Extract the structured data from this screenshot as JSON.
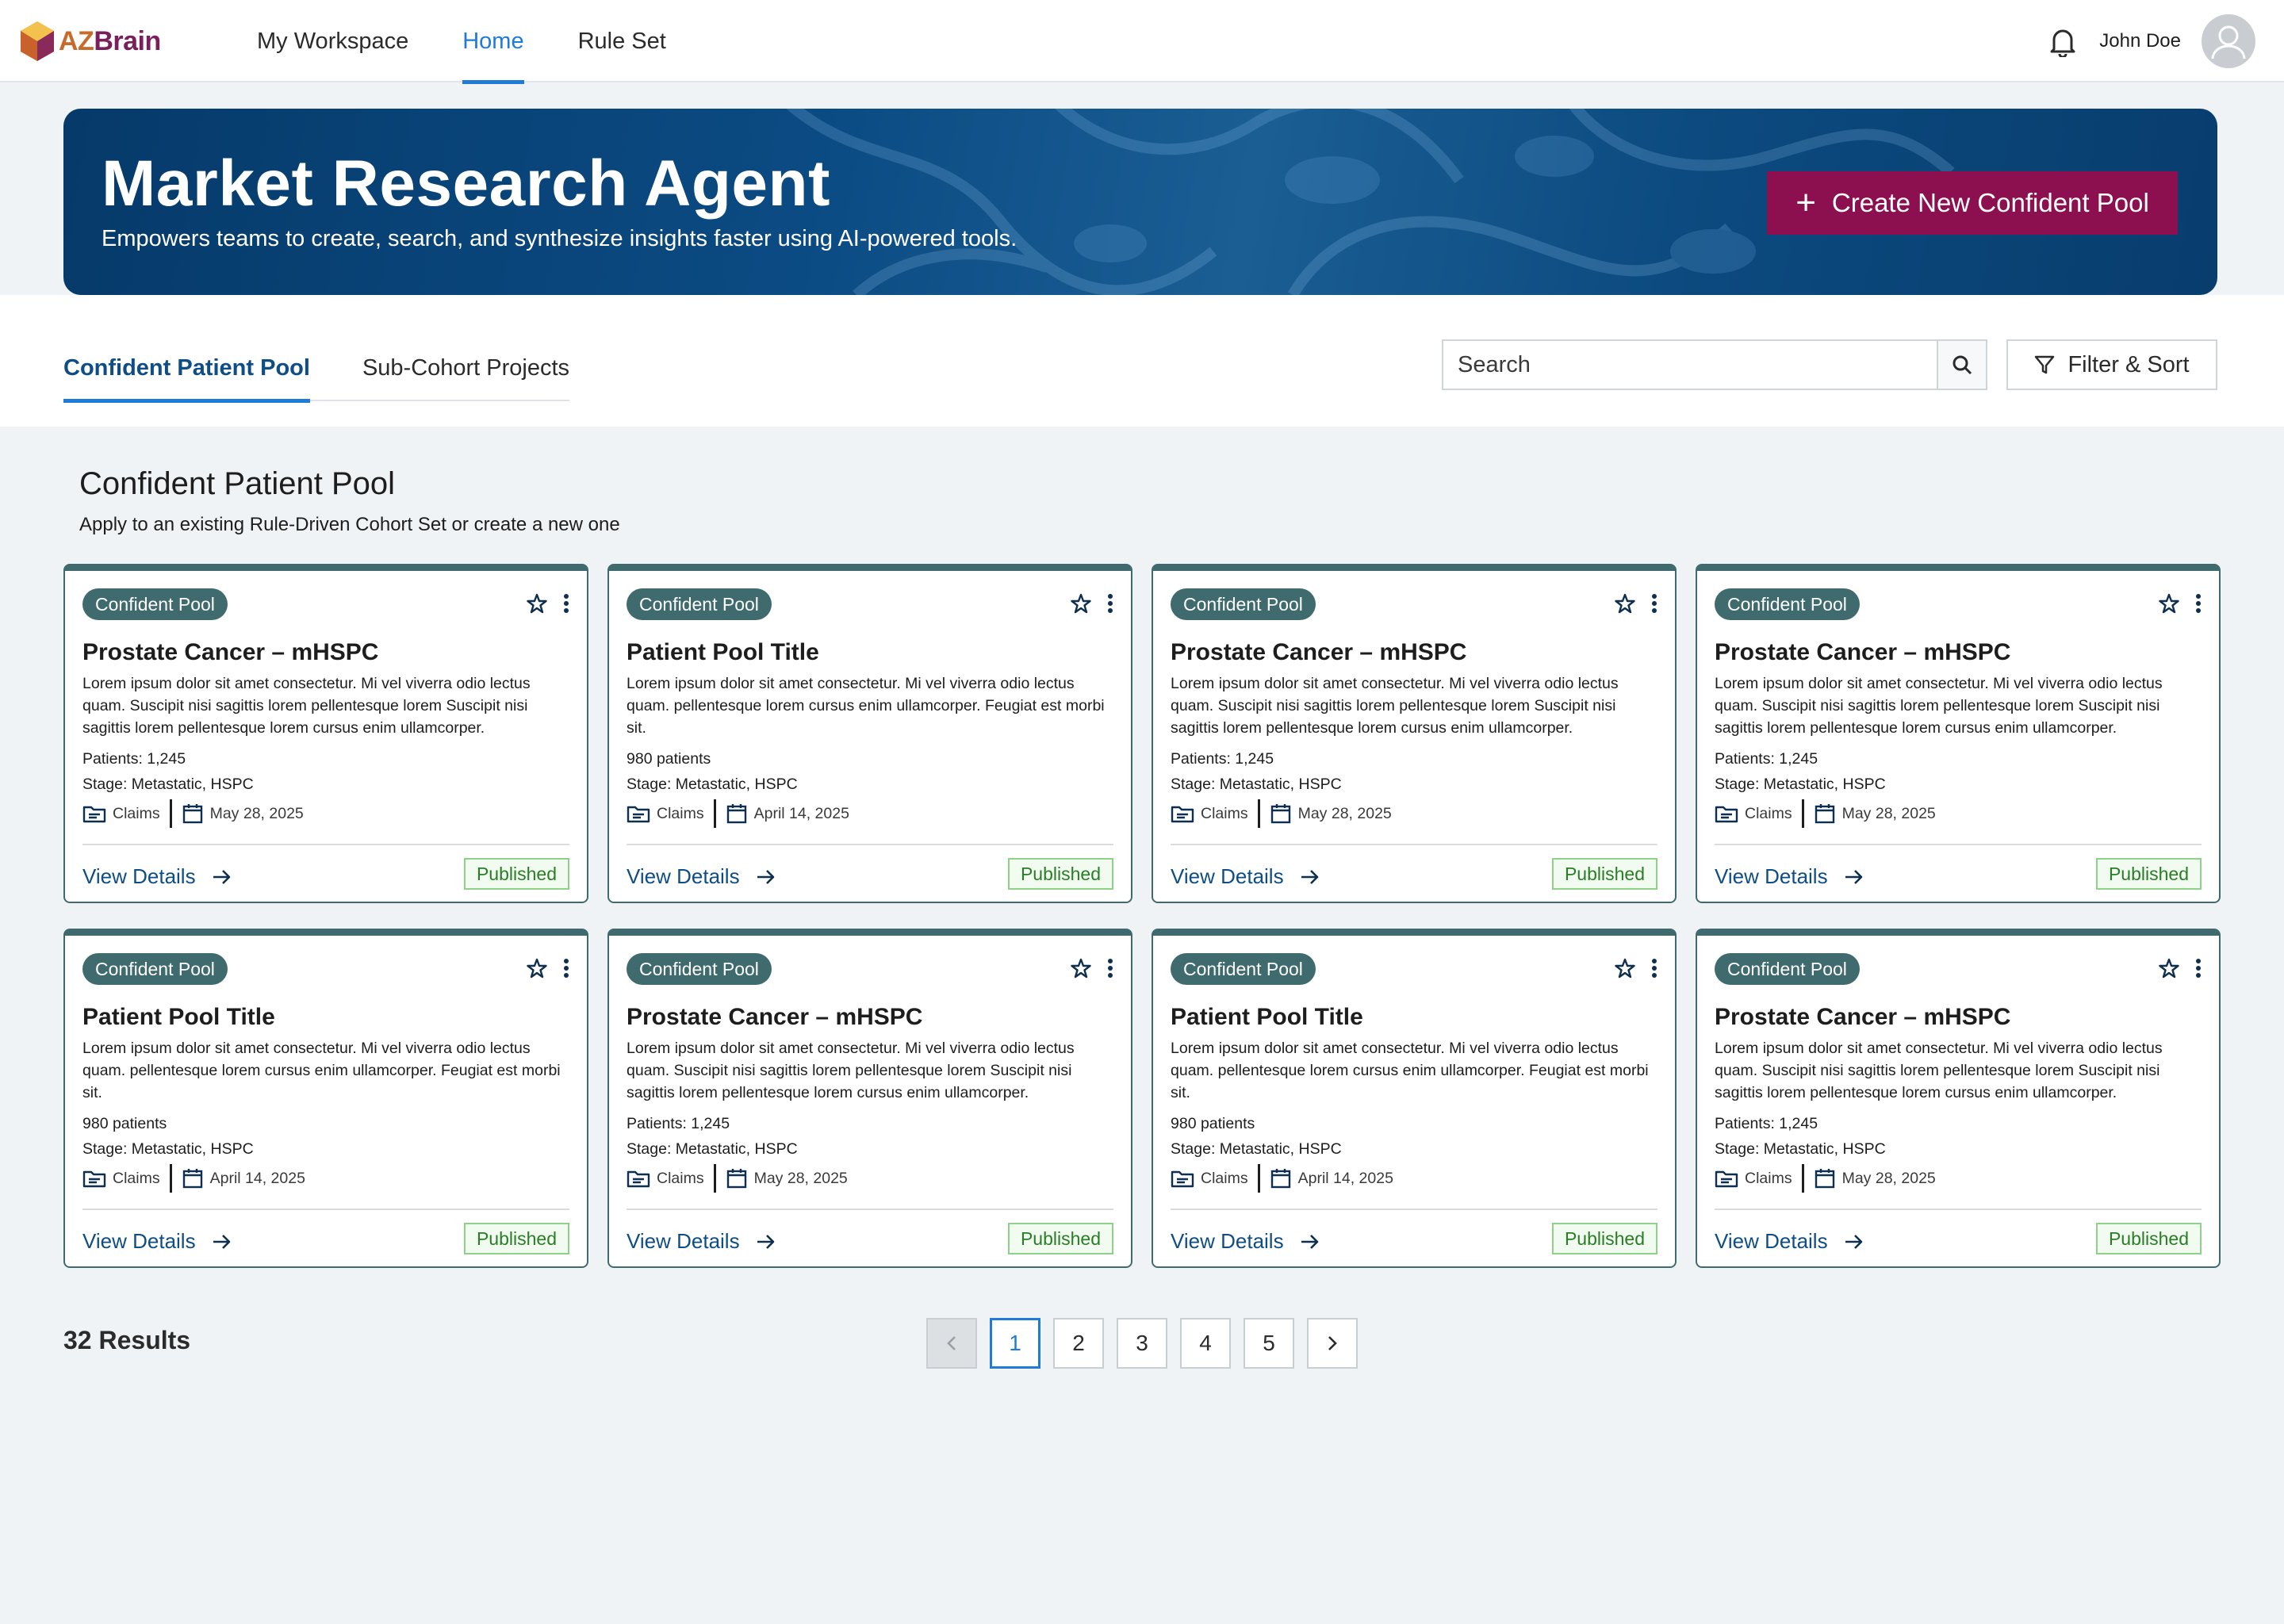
{
  "brand": {
    "logo_az": "AZ",
    "logo_brain": "Brain"
  },
  "nav": {
    "tabs": [
      {
        "label": "My Workspace"
      },
      {
        "label": "Home"
      },
      {
        "label": "Rule Set"
      }
    ],
    "active_tab": "Home",
    "user_name": "John Doe"
  },
  "hero": {
    "title": "Market Research Agent",
    "subtitle": "Empowers teams to create, search, and synthesize insights faster using AI-powered tools.",
    "create_label": "Create New Confident Pool"
  },
  "subtabs": [
    {
      "label": "Confident Patient Pool"
    },
    {
      "label": "Sub-Cohort Projects"
    }
  ],
  "search": {
    "placeholder": "Search"
  },
  "filter_label": "Filter & Sort",
  "section": {
    "title": "Confident Patient Pool",
    "subtitle": "Apply to an existing Rule-Driven Cohort Set or create a new one"
  },
  "cards": [
    {
      "badge": "Confident Pool",
      "title": "Prostate Cancer – mHSPC",
      "description": "Lorem ipsum dolor sit amet consectetur. Mi vel viverra odio lectus quam. Suscipit nisi sagittis lorem pellentesque lorem Suscipit nisi sagittis lorem pellentesque lorem cursus enim ullamcorper.",
      "patients": "Patients: 1,245",
      "stage": "Stage: Metastatic, HSPC",
      "source": "Claims",
      "date": "May 28, 2025",
      "link": "View Details",
      "status": "Published"
    },
    {
      "badge": "Confident Pool",
      "title": "Patient Pool Title",
      "description": "Lorem ipsum dolor sit amet consectetur. Mi vel viverra odio lectus quam.  pellentesque lorem cursus enim ullamcorper. Feugiat est morbi sit.",
      "patients": "980 patients",
      "stage": "Stage: Metastatic, HSPC",
      "source": "Claims",
      "date": "April 14, 2025",
      "link": "View Details",
      "status": "Published"
    },
    {
      "badge": "Confident Pool",
      "title": "Prostate Cancer – mHSPC",
      "description": "Lorem ipsum dolor sit amet consectetur. Mi vel viverra odio lectus quam. Suscipit nisi sagittis lorem pellentesque lorem Suscipit nisi sagittis lorem pellentesque lorem cursus enim ullamcorper.",
      "patients": "Patients: 1,245",
      "stage": "Stage: Metastatic, HSPC",
      "source": "Claims",
      "date": "May 28, 2025",
      "link": "View Details",
      "status": "Published"
    },
    {
      "badge": "Confident Pool",
      "title": "Prostate Cancer – mHSPC",
      "description": "Lorem ipsum dolor sit amet consectetur. Mi vel viverra odio lectus quam. Suscipit nisi sagittis lorem pellentesque lorem Suscipit nisi sagittis lorem pellentesque lorem cursus enim ullamcorper.",
      "patients": "Patients: 1,245",
      "stage": "Stage: Metastatic, HSPC",
      "source": "Claims",
      "date": "May 28, 2025",
      "link": "View Details",
      "status": "Published"
    },
    {
      "badge": "Confident Pool",
      "title": "Patient Pool Title",
      "description": "Lorem ipsum dolor sit amet consectetur. Mi vel viverra odio lectus quam.  pellentesque lorem cursus enim ullamcorper. Feugiat est morbi sit.",
      "patients": "980 patients",
      "stage": "Stage: Metastatic, HSPC",
      "source": "Claims",
      "date": "April 14, 2025",
      "link": "View Details",
      "status": "Published"
    },
    {
      "badge": "Confident Pool",
      "title": "Prostate Cancer – mHSPC",
      "description": "Lorem ipsum dolor sit amet consectetur. Mi vel viverra odio lectus quam. Suscipit nisi sagittis lorem pellentesque lorem Suscipit nisi sagittis lorem pellentesque lorem cursus enim ullamcorper.",
      "patients": "Patients: 1,245",
      "stage": "Stage: Metastatic, HSPC",
      "source": "Claims",
      "date": "May 28, 2025",
      "link": "View Details",
      "status": "Published"
    },
    {
      "badge": "Confident Pool",
      "title": "Patient Pool Title",
      "description": "Lorem ipsum dolor sit amet consectetur. Mi vel viverra odio lectus quam.  pellentesque lorem cursus enim ullamcorper. Feugiat est morbi sit.",
      "patients": "980 patients",
      "stage": "Stage: Metastatic, HSPC",
      "source": "Claims",
      "date": "April 14, 2025",
      "link": "View Details",
      "status": "Published"
    },
    {
      "badge": "Confident Pool",
      "title": "Prostate Cancer – mHSPC",
      "description": "Lorem ipsum dolor sit amet consectetur. Mi vel viverra odio lectus quam. Suscipit nisi sagittis lorem pellentesque lorem Suscipit nisi sagittis lorem pellentesque lorem cursus enim ullamcorper.",
      "patients": "Patients: 1,245",
      "stage": "Stage: Metastatic, HSPC",
      "source": "Claims",
      "date": "May 28, 2025",
      "link": "View Details",
      "status": "Published"
    }
  ],
  "results_label": "32 Results",
  "pagination": {
    "pages": [
      "1",
      "2",
      "3",
      "4",
      "5"
    ],
    "current": "1",
    "prev_icon": "chevron-left-icon",
    "next_icon": "chevron-right-icon"
  },
  "colors": {
    "brand_accent": "#8c0f4f",
    "hero_blue": "#0b4b83",
    "card_teal": "#3f6b6e",
    "link_blue": "#0e4d86",
    "active_blue": "#1f7ad8",
    "status_green": "#2a7d27"
  }
}
